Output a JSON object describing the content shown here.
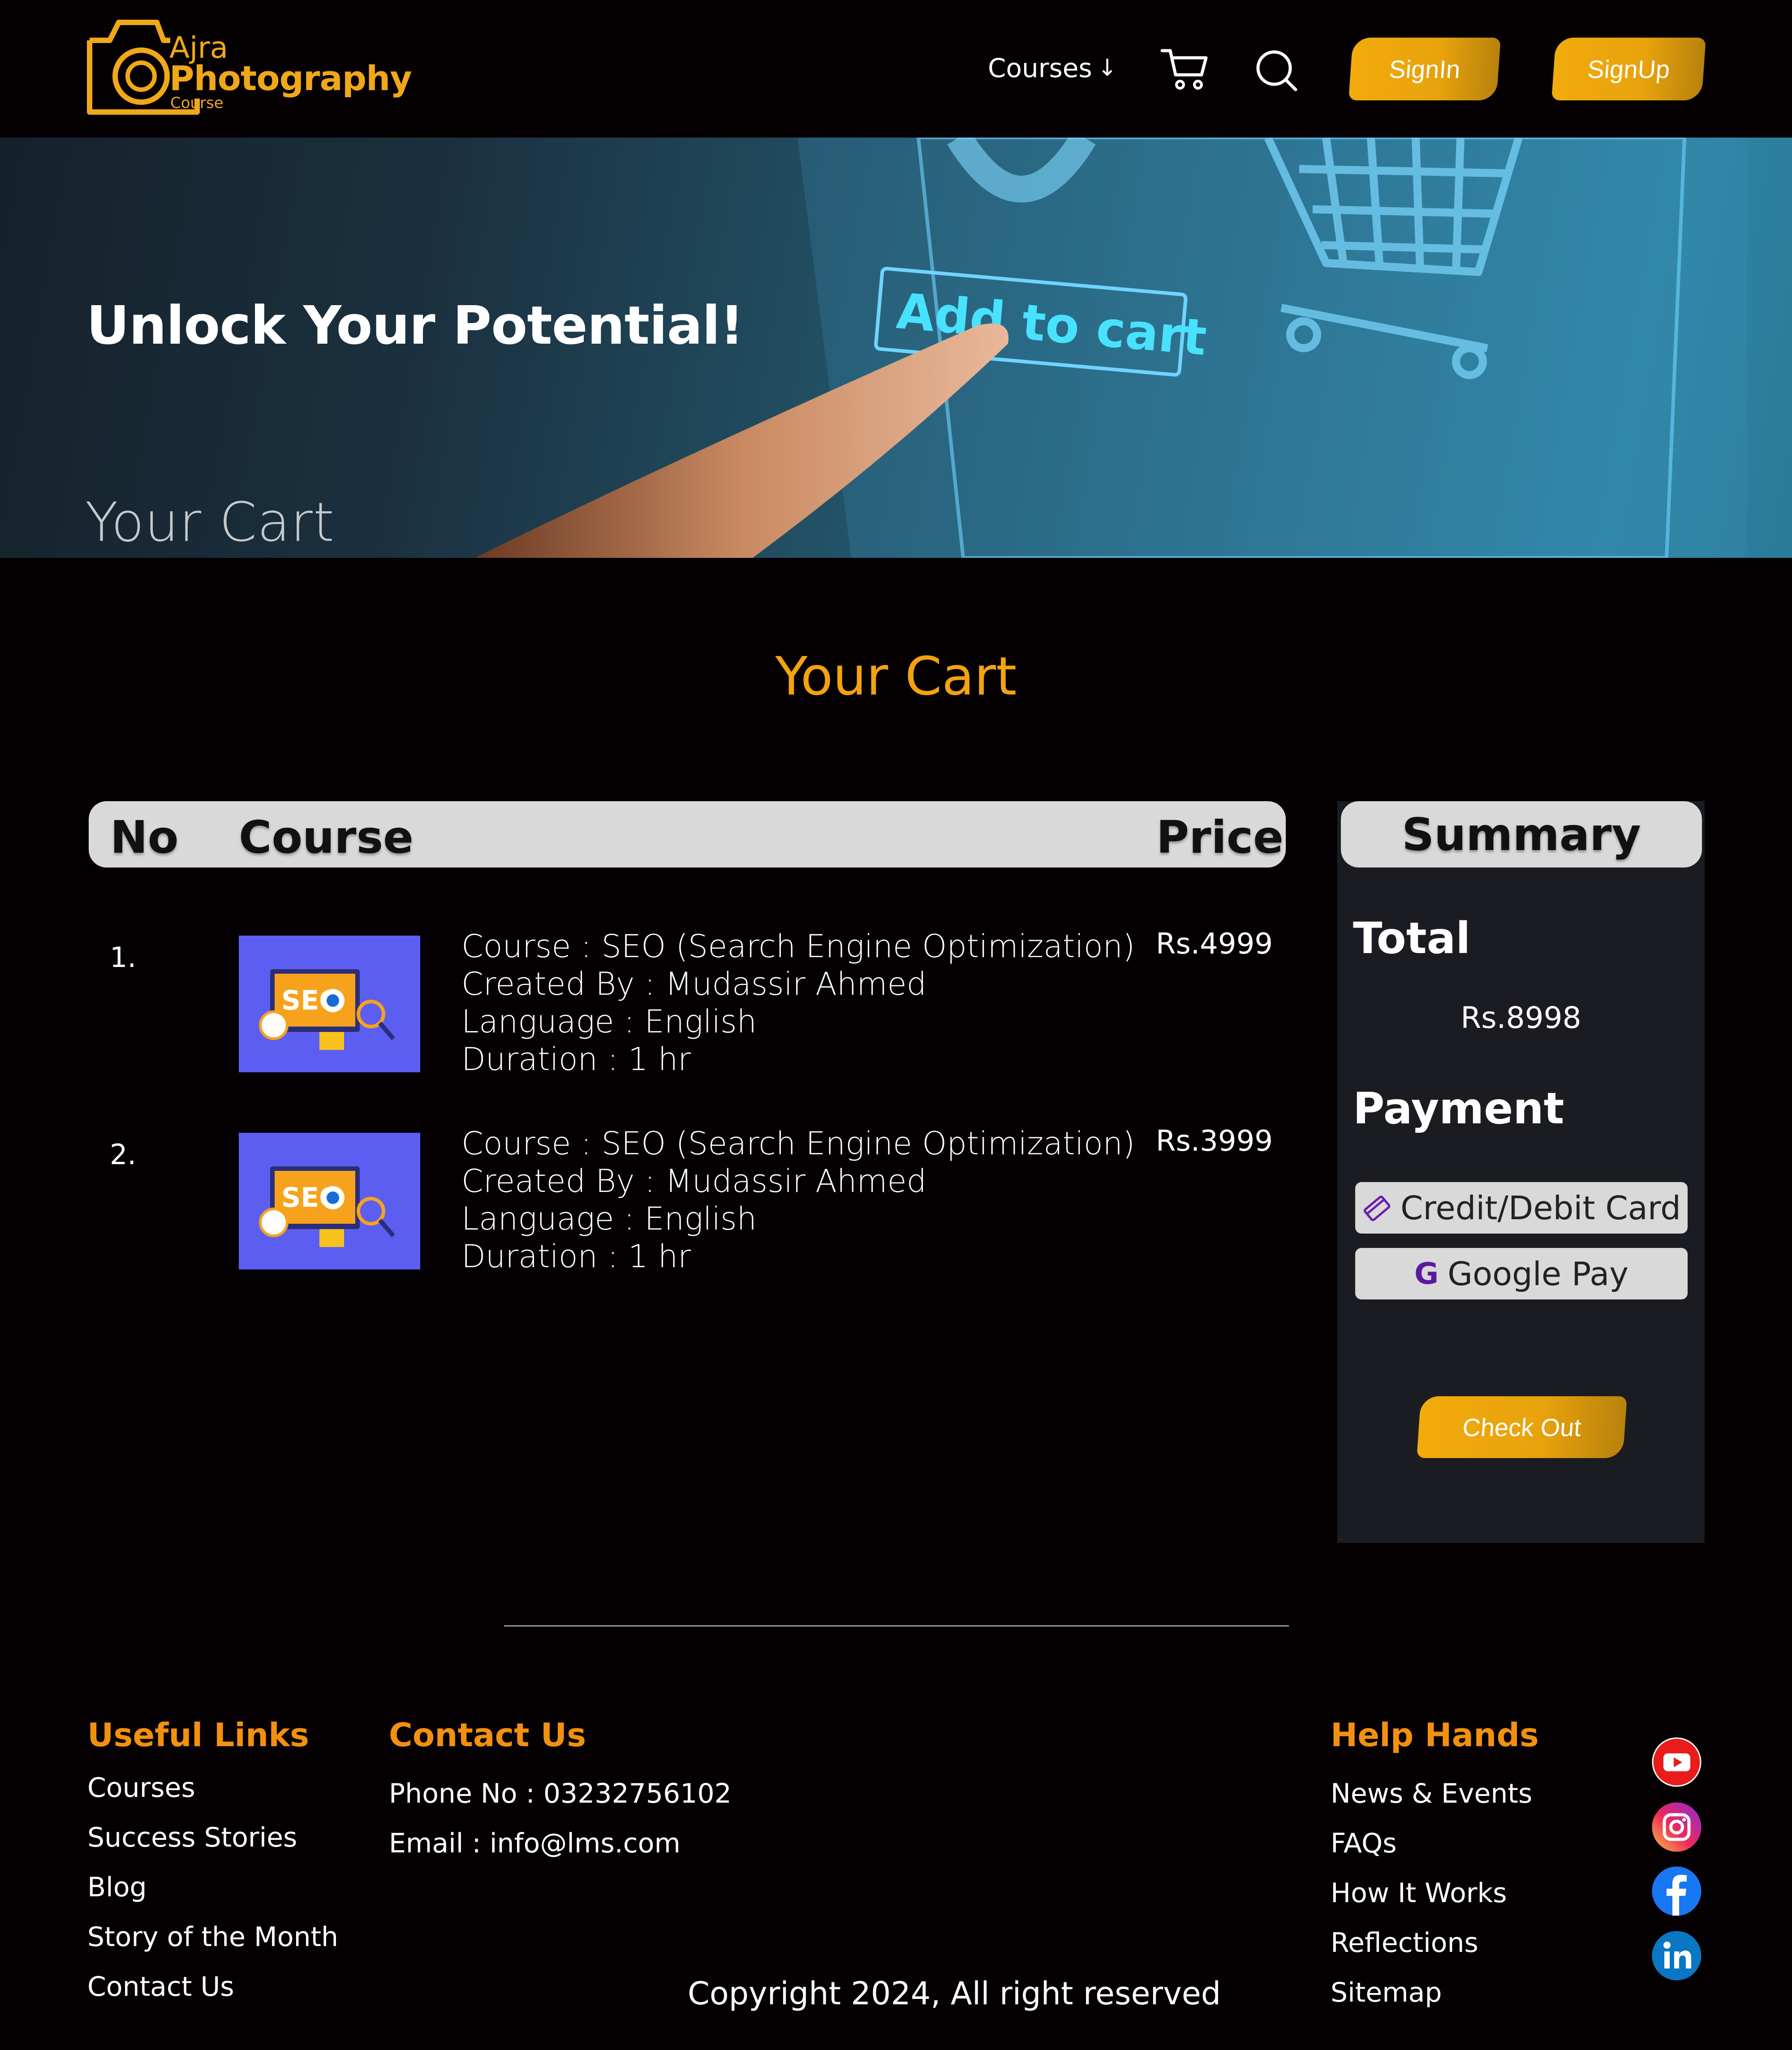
{
  "header": {
    "logo": {
      "line1": "Ajra",
      "line2": "Photography",
      "line3": "Course"
    },
    "nav_courses": "Courses",
    "nav_courses_arrow": "↓",
    "signin_label": "SignIn",
    "signup_label": "SignUp",
    "cart_icon": "cart-icon",
    "search_icon": "search-icon",
    "accent_color": "#f2a30f"
  },
  "hero": {
    "title": "Unlock Your Potential!",
    "subtitle": "Your Cart",
    "image_text": "Add to cart"
  },
  "main": {
    "title": "Your Cart",
    "table": {
      "headers": {
        "no": "No",
        "course": "Course",
        "price": "Price"
      },
      "rows": [
        {
          "no": "1.",
          "thumb_text": "SEO",
          "course": "Course : SEO (Search Engine Optimization)",
          "created_by": "Created By : Mudassir Ahmed",
          "language": "Language : English",
          "duration": "Duration : 1 hr",
          "price": "Rs.4999"
        },
        {
          "no": "2.",
          "thumb_text": "SEO",
          "course": "Course : SEO (Search Engine Optimization)",
          "created_by": "Created By : Mudassir Ahmed",
          "language": "Language : English",
          "duration": "Duration : 1 hr",
          "price": "Rs.3999"
        }
      ]
    },
    "summary": {
      "heading": "Summary",
      "total_label": "Total",
      "total_value": "Rs.8998",
      "payment_label": "Payment",
      "payment_options": [
        {
          "label": "Credit/Debit Card",
          "icon": "card-icon"
        },
        {
          "label": "Google Pay",
          "icon": "google-icon",
          "icon_text": "G"
        }
      ],
      "checkout_label": "Check Out"
    }
  },
  "footer": {
    "useful_links": {
      "heading": "Useful Links",
      "items": [
        "Courses",
        "Success Stories",
        "Blog",
        "Story of the Month",
        "Contact Us"
      ]
    },
    "contact": {
      "heading": "Contact Us",
      "phone": "Phone No : 03232756102",
      "email": "Email : info@lms.com"
    },
    "help": {
      "heading": "Help Hands",
      "items": [
        "News & Events",
        "FAQs",
        "How It Works",
        "Reflections",
        "Sitemap"
      ]
    },
    "copyright": "Copyright 2024, All right reserved",
    "social": [
      "youtube-icon",
      "instagram-icon",
      "facebook-icon",
      "linkedin-icon"
    ]
  }
}
